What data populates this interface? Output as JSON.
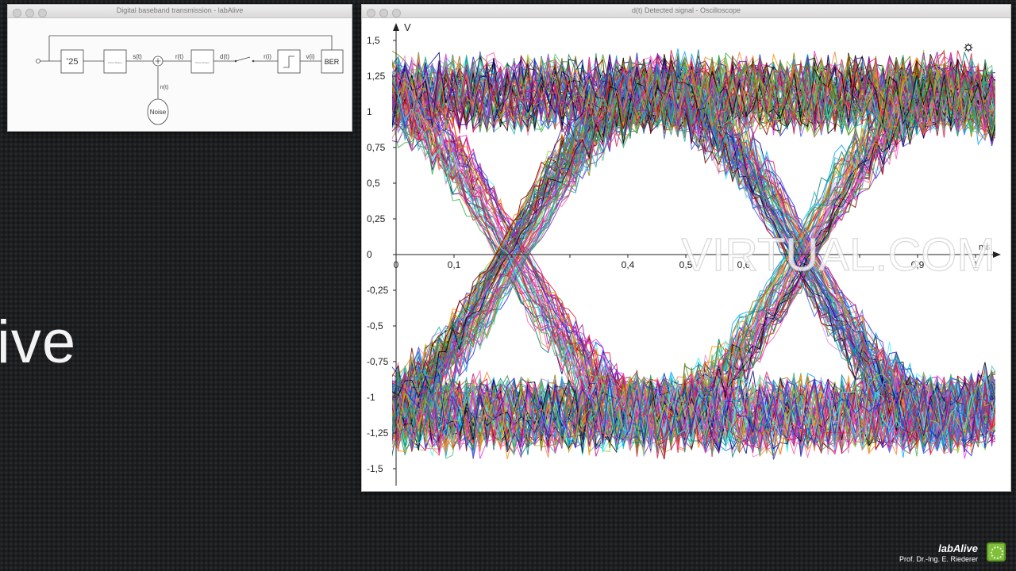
{
  "block_window": {
    "title": "Digital baseband transmission - labAlive",
    "blocks": {
      "gain": "25",
      "gain_prefix": "*",
      "pulse_shaper": "Pulse Shaper",
      "receive_filter": "Pulse Shaper",
      "noise": "Noise",
      "ber": "BER"
    },
    "signals": {
      "s": "s(t)",
      "r": "r(t)",
      "d": "d(t)",
      "ri": "r(i)",
      "vi": "v(i)",
      "n": "n(t)"
    }
  },
  "scope_window": {
    "title": "d(t) Detected signal - Oscilloscope",
    "y_unit": "V",
    "x_unit": "ms",
    "watermark": "VIRTUAL.COM"
  },
  "left_text": "ive",
  "branding": {
    "name": "labAlive",
    "author": "Prof. Dr.-Ing. E. Riederer"
  },
  "chart_data": {
    "type": "line",
    "title": "",
    "xlabel": "ms",
    "ylabel": "V",
    "xlim": [
      0,
      1
    ],
    "ylim": [
      -1.6,
      1.6
    ],
    "x_ticks": [
      0,
      0.1,
      0.2,
      0.3,
      0.4,
      0.5,
      0.6,
      0.7,
      0.8,
      0.9,
      1
    ],
    "x_tick_labels": [
      "0",
      "0,1",
      "",
      "",
      "0,4",
      "0,5",
      "0,6",
      "",
      "",
      "0,9",
      "1"
    ],
    "y_ticks": [
      1.5,
      1.25,
      1,
      0.75,
      0.5,
      0.25,
      0,
      -0.25,
      -0.5,
      -0.75,
      -1,
      -1.25,
      -1.5
    ],
    "y_tick_labels": [
      "1,5",
      "1,25",
      "1",
      "0,75",
      "0,5",
      "0,25",
      "0",
      "-0,25",
      "-0,5",
      "-0,75",
      "-1",
      "-1,25",
      "-1,5"
    ],
    "grid": false,
    "plot": "eye diagram",
    "symbol_period": 0.5,
    "eye_crossings_x": [
      0.2,
      0.7
    ],
    "levels": [
      1,
      -1
    ],
    "trace_peak_max": 1.65,
    "trace_count": 260,
    "trace_colors": [
      "#e6194b",
      "#3cb44b",
      "#4363d8",
      "#f58231",
      "#911eb4",
      "#46f0f0",
      "#f032e6",
      "#9acd32",
      "#1f2bd8",
      "#008080",
      "#e08fd6",
      "#9a6324",
      "#800000",
      "#52c77a",
      "#808000",
      "#000075",
      "#ff5aa5",
      "#00a6ff",
      "#c71585",
      "#2e8b57",
      "#6a5acd",
      "#ff8c00",
      "#20b2aa",
      "#dc143c",
      "#000000"
    ]
  }
}
